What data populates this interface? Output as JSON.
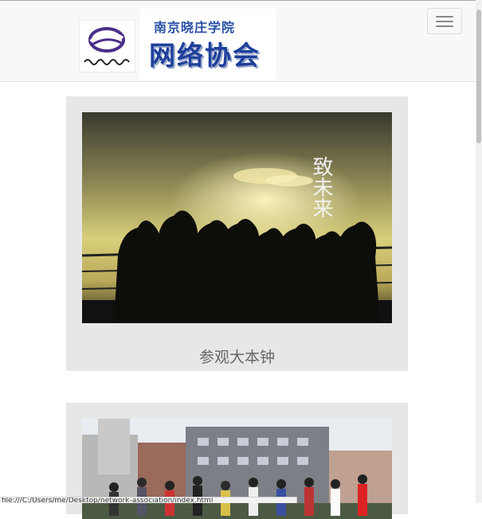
{
  "header": {
    "school_name": "南京晓庄学院",
    "club_name": "网络协会",
    "menu_toggle_icon": "hamburger-icon"
  },
  "cards": [
    {
      "photo_overlay_text": "致未来",
      "caption": "参观大本钟"
    },
    {
      "caption": ""
    }
  ],
  "statusbar": {
    "text": "file:///C:/Users/me/Desktop/network-association/index.html"
  },
  "colors": {
    "navbar_bg": "#f8f8f8",
    "card_bg": "#e7e7e7",
    "caption_text": "#666666",
    "logo_blue": "#1e3f9c"
  }
}
